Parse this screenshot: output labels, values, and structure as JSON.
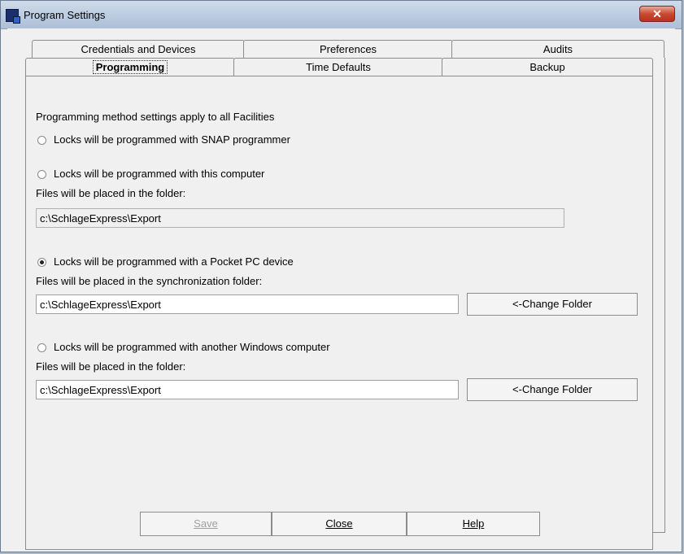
{
  "window": {
    "title": "Program Settings",
    "close_symbol": "✕"
  },
  "tabs": {
    "back_row": [
      {
        "label": "Credentials and Devices"
      },
      {
        "label": "Preferences"
      },
      {
        "label": "Audits"
      }
    ],
    "front_row": [
      {
        "label": "Programming",
        "active": true
      },
      {
        "label": "Time Defaults"
      },
      {
        "label": "Backup"
      }
    ]
  },
  "panel": {
    "intro": "Programming method settings apply to all Facilities",
    "option_snap": "Locks will be programmed with SNAP programmer",
    "option_computer": "Locks will be programmed with this computer",
    "computer_folder_label": "Files will be placed in the folder:",
    "computer_folder_value": "c:\\SchlageExpress\\Export",
    "option_pocketpc": "Locks will be programmed with a Pocket PC device",
    "pocketpc_folder_label": "Files will be placed in the synchronization folder:",
    "pocketpc_folder_value": "c:\\SchlageExpress\\Export",
    "change_folder_1": "<-Change Folder",
    "option_windows": "Locks will be programmed with another Windows computer",
    "windows_folder_label": "Files will be placed in the folder:",
    "windows_folder_value": "c:\\SchlageExpress\\Export",
    "change_folder_2": "<-Change Folder",
    "selected_option": "pocketpc"
  },
  "footer": {
    "save": "Save",
    "close": "Close",
    "help": "Help"
  }
}
